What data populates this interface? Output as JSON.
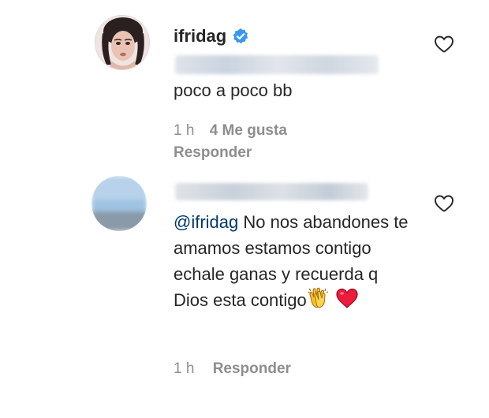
{
  "comments": [
    {
      "username": "ifridag",
      "verified": true,
      "text": "poco a poco bb",
      "time": "1 h",
      "likes": "4 Me gusta",
      "reply_label": "Responder"
    },
    {
      "mention": "@ifridag",
      "text": " No nos abandones te amamos estamos contigo echale ganas y recuerda q Dios esta contigo",
      "emojis": [
        "clapping-hands-emoji",
        "red-heart-emoji"
      ],
      "time": "1 h",
      "reply_label": "Responder"
    }
  ],
  "colors": {
    "text": "#262626",
    "secondary": "#8e8e8e",
    "mention": "#00376b",
    "verified": "#3897f0",
    "heart_red": "#ed1c3c"
  }
}
